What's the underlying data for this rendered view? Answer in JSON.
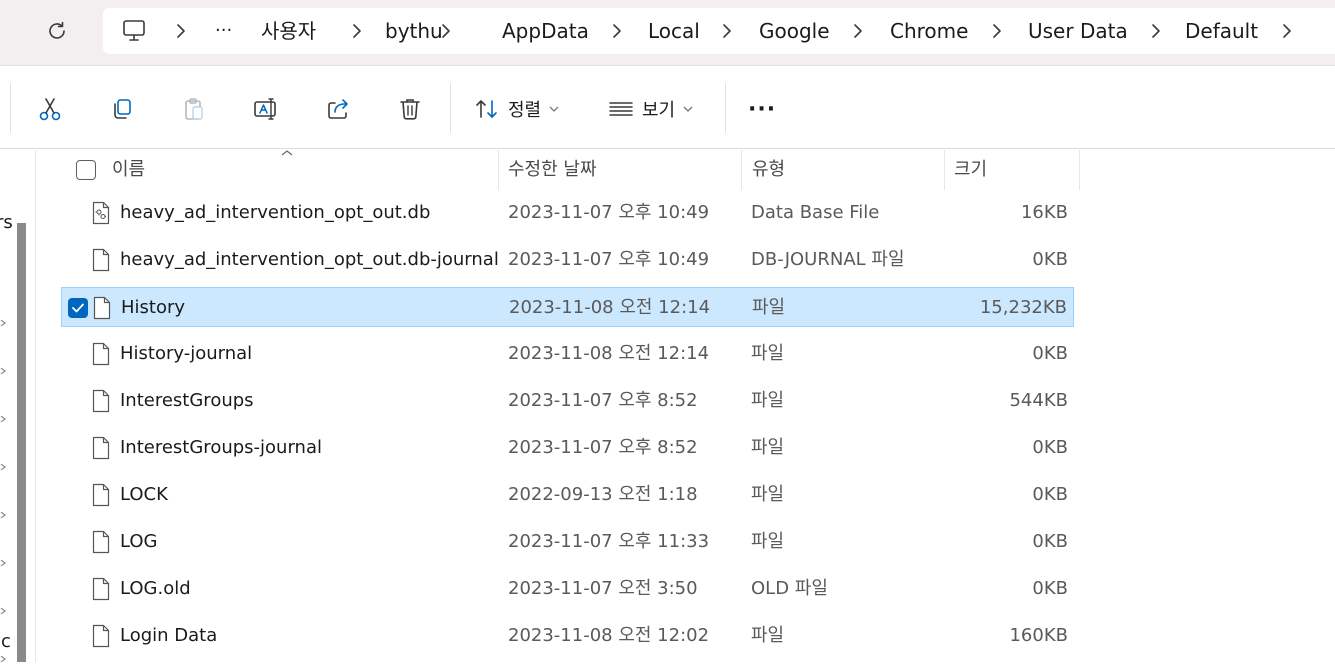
{
  "colors": {
    "accent": "#0067c0",
    "selection_bg": "#cce8ff",
    "selection_border": "#99d1ff",
    "address_band": "#f3eef0"
  },
  "address_bar": {
    "ellipsis": "···",
    "crumbs": [
      "사용자",
      "bythu",
      "AppData",
      "Local",
      "Google",
      "Chrome",
      "User Data",
      "Default"
    ]
  },
  "toolbar": {
    "sort_label": "정렬",
    "view_label": "보기",
    "more_label": "···"
  },
  "left_pane": {
    "partial_text_1": "rs",
    "partial_text_2": "ic"
  },
  "columns": {
    "name": "이름",
    "date": "수정한 날짜",
    "type": "유형",
    "size": "크기"
  },
  "files": [
    {
      "name": "heavy_ad_intervention_opt_out.db",
      "date": "2023-11-07 오후 10:49",
      "type": "Data Base File",
      "size": "16KB",
      "icon": "database-file-icon",
      "selected": false
    },
    {
      "name": "heavy_ad_intervention_opt_out.db-journal",
      "date": "2023-11-07 오후 10:49",
      "type": "DB-JOURNAL 파일",
      "size": "0KB",
      "icon": "file-icon",
      "selected": false
    },
    {
      "name": "History",
      "date": "2023-11-08 오전 12:14",
      "type": "파일",
      "size": "15,232KB",
      "icon": "file-icon",
      "selected": true
    },
    {
      "name": "History-journal",
      "date": "2023-11-08 오전 12:14",
      "type": "파일",
      "size": "0KB",
      "icon": "file-icon",
      "selected": false
    },
    {
      "name": "InterestGroups",
      "date": "2023-11-07 오후 8:52",
      "type": "파일",
      "size": "544KB",
      "icon": "file-icon",
      "selected": false
    },
    {
      "name": "InterestGroups-journal",
      "date": "2023-11-07 오후 8:52",
      "type": "파일",
      "size": "0KB",
      "icon": "file-icon",
      "selected": false
    },
    {
      "name": "LOCK",
      "date": "2022-09-13 오전 1:18",
      "type": "파일",
      "size": "0KB",
      "icon": "file-icon",
      "selected": false
    },
    {
      "name": "LOG",
      "date": "2023-11-07 오후 11:33",
      "type": "파일",
      "size": "0KB",
      "icon": "file-icon",
      "selected": false
    },
    {
      "name": "LOG.old",
      "date": "2023-11-07 오전 3:50",
      "type": "OLD 파일",
      "size": "0KB",
      "icon": "file-icon",
      "selected": false
    },
    {
      "name": "Login Data",
      "date": "2023-11-08 오전 12:02",
      "type": "파일",
      "size": "160KB",
      "icon": "file-icon",
      "selected": false
    }
  ]
}
